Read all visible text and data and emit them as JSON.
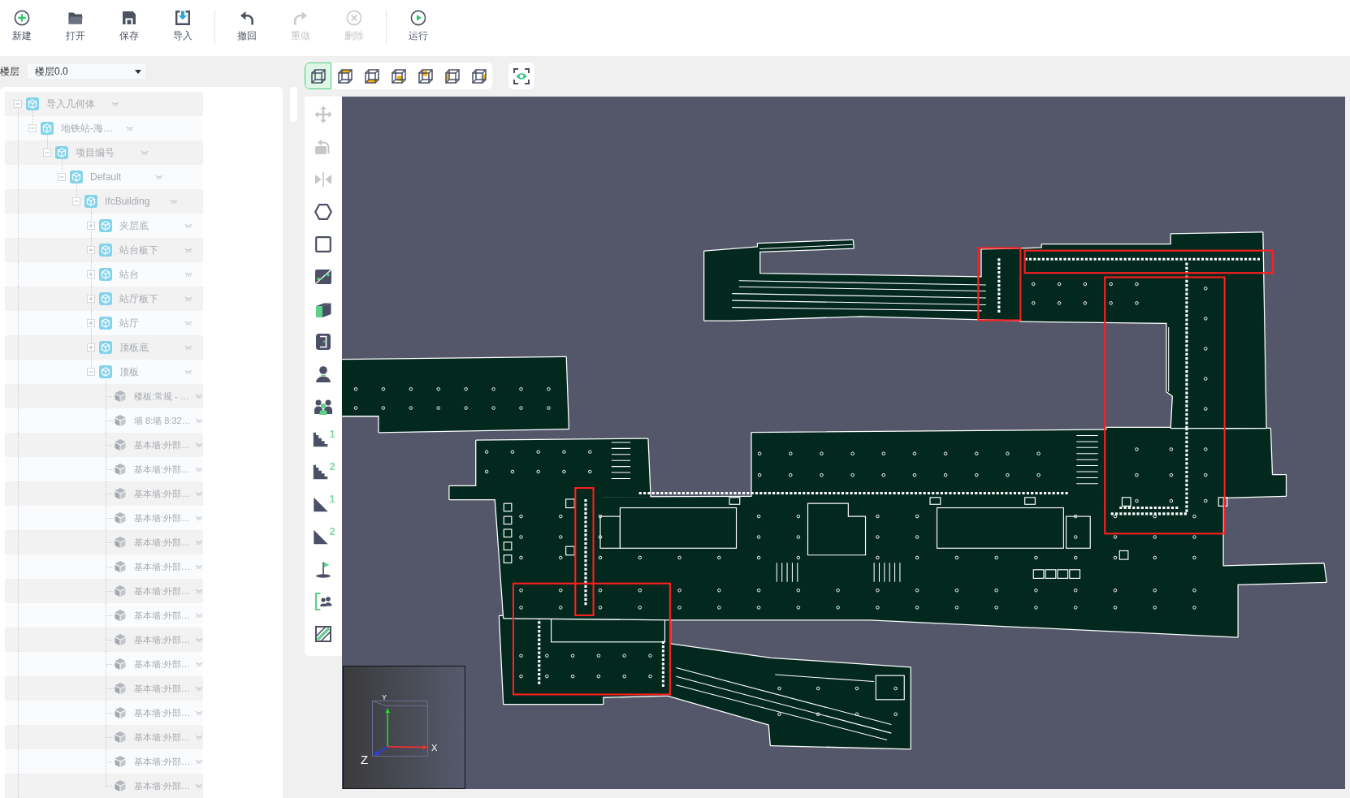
{
  "toolbar": {
    "groups": [
      {
        "buttons": [
          {
            "kind": "new",
            "label": "新建",
            "disabled": false
          },
          {
            "kind": "open",
            "label": "打开",
            "disabled": false
          },
          {
            "kind": "save",
            "label": "保存",
            "disabled": false
          },
          {
            "kind": "import",
            "label": "导入",
            "disabled": false
          }
        ]
      },
      {
        "buttons": [
          {
            "kind": "undo",
            "label": "撤回",
            "disabled": false
          },
          {
            "kind": "redo",
            "label": "重做",
            "disabled": true
          },
          {
            "kind": "delete",
            "label": "删除",
            "disabled": true
          }
        ]
      },
      {
        "buttons": [
          {
            "kind": "run",
            "label": "运行",
            "disabled": false
          }
        ]
      }
    ]
  },
  "floor_selector": {
    "label": "楼层",
    "value": "楼层0.0"
  },
  "tree": [
    {
      "kind": "group",
      "label": "导入几何体",
      "expanded": true,
      "children": [
        {
          "kind": "group",
          "label": "地铁站-海…",
          "expanded": true,
          "children": [
            {
              "kind": "group",
              "label": "项目编号",
              "expanded": true,
              "children": [
                {
                  "kind": "group",
                  "label": "Default",
                  "expanded": true,
                  "children": [
                    {
                      "kind": "group",
                      "label": "IfcBuilding",
                      "expanded": true,
                      "children": [
                        {
                          "kind": "group",
                          "label": "夹层底",
                          "expanded": false
                        },
                        {
                          "kind": "group",
                          "label": "站台板下",
                          "expanded": false
                        },
                        {
                          "kind": "group",
                          "label": "站台",
                          "expanded": false
                        },
                        {
                          "kind": "group",
                          "label": "站厅板下",
                          "expanded": false
                        },
                        {
                          "kind": "group",
                          "label": "站厅",
                          "expanded": false
                        },
                        {
                          "kind": "group",
                          "label": "顶板底",
                          "expanded": false
                        },
                        {
                          "kind": "group",
                          "label": "顶板",
                          "expanded": true,
                          "children": [
                            {
                              "kind": "element",
                              "label": "楼板:常规 - …"
                            },
                            {
                              "kind": "element",
                              "label": "墙 8:墙 8:32…"
                            },
                            {
                              "kind": "element",
                              "label": "基本墙:外部…"
                            },
                            {
                              "kind": "element",
                              "label": "基本墙:外部…"
                            },
                            {
                              "kind": "element",
                              "label": "基本墙:外部…"
                            },
                            {
                              "kind": "element",
                              "label": "基本墙:外部…"
                            },
                            {
                              "kind": "element",
                              "label": "基本墙:外部…"
                            },
                            {
                              "kind": "element",
                              "label": "基本墙:外部…"
                            },
                            {
                              "kind": "element",
                              "label": "基本墙:外部…"
                            },
                            {
                              "kind": "element",
                              "label": "基本墙:外部…"
                            },
                            {
                              "kind": "element",
                              "label": "基本墙:外部…"
                            },
                            {
                              "kind": "element",
                              "label": "基本墙:外部…"
                            },
                            {
                              "kind": "element",
                              "label": "基本墙:外部…"
                            },
                            {
                              "kind": "element",
                              "label": "基本墙:外部…"
                            },
                            {
                              "kind": "element",
                              "label": "基本墙:外部…"
                            },
                            {
                              "kind": "element",
                              "label": "基本墙:外部…"
                            },
                            {
                              "kind": "element",
                              "label": "基本墙:外部…"
                            }
                          ]
                        }
                      ]
                    }
                  ]
                }
              ]
            }
          ]
        }
      ]
    }
  ],
  "view_buttons": [
    {
      "kind": "perspective",
      "selected": true
    },
    {
      "kind": "top",
      "selected": false
    },
    {
      "kind": "bottom",
      "selected": false
    },
    {
      "kind": "front",
      "selected": false
    },
    {
      "kind": "back",
      "selected": false
    },
    {
      "kind": "left",
      "selected": false
    },
    {
      "kind": "right",
      "selected": false
    }
  ],
  "tools": [
    {
      "kind": "move",
      "disabled": true
    },
    {
      "kind": "rotate",
      "disabled": true
    },
    {
      "kind": "mirror",
      "disabled": true
    },
    {
      "kind": "polygon",
      "disabled": false
    },
    {
      "kind": "rectangle",
      "disabled": false
    },
    {
      "kind": "split",
      "disabled": false
    },
    {
      "kind": "wall",
      "disabled": false
    },
    {
      "kind": "door",
      "disabled": false
    },
    {
      "kind": "person",
      "disabled": false
    },
    {
      "kind": "crowd",
      "disabled": false
    },
    {
      "kind": "stairs",
      "badge": "1",
      "disabled": false
    },
    {
      "kind": "stairs",
      "badge": "2",
      "disabled": false
    },
    {
      "kind": "ramp",
      "badge": "1",
      "disabled": false
    },
    {
      "kind": "ramp",
      "badge": "2",
      "disabled": false
    },
    {
      "kind": "flag",
      "disabled": false
    },
    {
      "kind": "evacuation",
      "disabled": false
    },
    {
      "kind": "hatch",
      "disabled": false
    }
  ],
  "viewport": {
    "axes": [
      {
        "label": "X",
        "color": "#ff2a2a"
      },
      {
        "label": "Y",
        "color": "#22dd22"
      },
      {
        "label": "Z",
        "color": "#2a3cff"
      }
    ]
  }
}
